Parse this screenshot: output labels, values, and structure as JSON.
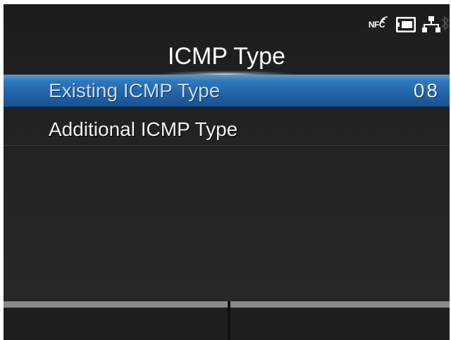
{
  "status_bar": {
    "nfc_label": "NFC",
    "icons": [
      "nfc-icon",
      "sd-card-icon",
      "network-icon",
      "bluetooth-icon"
    ]
  },
  "header": {
    "title": "ICMP Type"
  },
  "menu": {
    "items": [
      {
        "label": "Existing ICMP Type",
        "value": "08",
        "selected": true
      },
      {
        "label": "Additional ICMP Type",
        "value": "",
        "selected": false
      }
    ]
  },
  "softkeys": {
    "left": "",
    "right": ""
  },
  "colors": {
    "selected_row": "#1e5fa2",
    "background": "#222222",
    "text": "#ffffff"
  }
}
